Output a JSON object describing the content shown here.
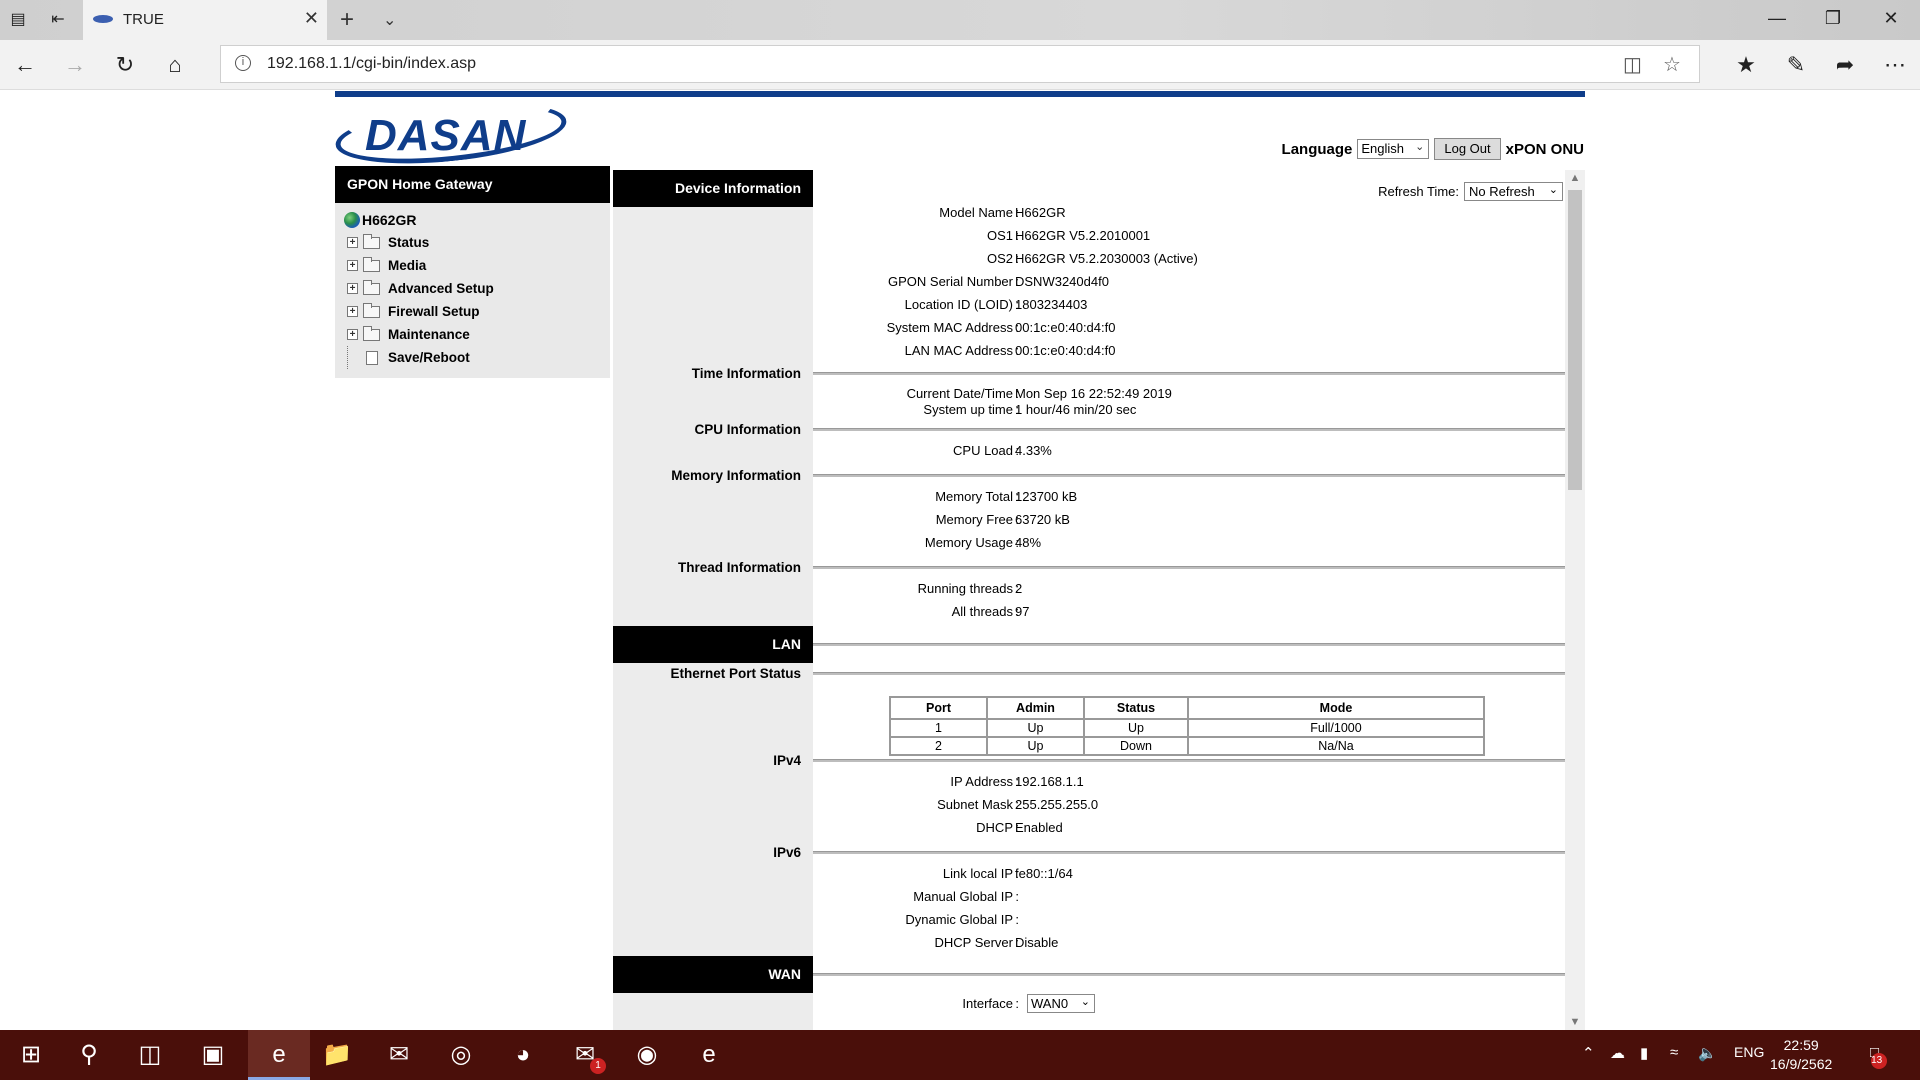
{
  "browser": {
    "tab_title": "TRUE",
    "url": "192.168.1.1/cgi-bin/index.asp"
  },
  "header": {
    "logo_text": "DASAN",
    "language_label": "Language",
    "language_value": "English",
    "logout_label": "Log Out",
    "product_name": "xPON ONU",
    "brand_color": "#0f3d8a"
  },
  "nav": {
    "title": "GPON Home Gateway",
    "root": "H662GR",
    "items": [
      {
        "label": "Status",
        "expandable": true
      },
      {
        "label": "Media",
        "expandable": true
      },
      {
        "label": "Advanced Setup",
        "expandable": true
      },
      {
        "label": "Firewall Setup",
        "expandable": true
      },
      {
        "label": "Maintenance",
        "expandable": true
      },
      {
        "label": "Save/Reboot",
        "expandable": false
      }
    ]
  },
  "refresh": {
    "label": "Refresh Time:",
    "value": "No Refresh"
  },
  "device_info": {
    "heading": "Device Information",
    "rows": [
      {
        "k": "Model Name",
        "v": "H662GR"
      },
      {
        "k": "OS1",
        "v": "H662GR V5.2.2010001"
      },
      {
        "k": "OS2",
        "v": "H662GR V5.2.2030003  (Active)"
      },
      {
        "k": "GPON Serial Number",
        "v": "DSNW3240d4f0"
      },
      {
        "k": "Location ID (LOID)",
        "v": "1803234403"
      },
      {
        "k": "System MAC Address",
        "v": "00:1c:e0:40:d4:f0"
      },
      {
        "k": "LAN MAC Address",
        "v": "00:1c:e0:40:d4:f0"
      }
    ]
  },
  "time_info": {
    "heading": "Time Information",
    "rows": [
      {
        "k": "Current Date/Time",
        "v": "Mon Sep 16 22:52:49 2019"
      },
      {
        "k": "System up time",
        "v": "1 hour/46 min/20 sec"
      }
    ]
  },
  "cpu_info": {
    "heading": "CPU Information",
    "rows": [
      {
        "k": "CPU Load",
        "v": "4.33%"
      }
    ]
  },
  "memory_info": {
    "heading": "Memory Information",
    "rows": [
      {
        "k": "Memory Total",
        "v": "123700 kB"
      },
      {
        "k": "Memory Free",
        "v": "63720 kB"
      },
      {
        "k": "Memory Usage",
        "v": "48%"
      }
    ]
  },
  "thread_info": {
    "heading": "Thread Information",
    "rows": [
      {
        "k": "Running threads",
        "v": "2"
      },
      {
        "k": "All threads",
        "v": "97"
      }
    ]
  },
  "lan": {
    "heading": "LAN",
    "ethernet_heading": "Ethernet Port Status",
    "columns": [
      "Port",
      "Admin",
      "Status",
      "Mode"
    ],
    "ports": [
      [
        "1",
        "Up",
        "Up",
        "Full/1000"
      ],
      [
        "2",
        "Up",
        "Down",
        "Na/Na"
      ]
    ],
    "ipv4_heading": "IPv4",
    "ipv4_rows": [
      {
        "k": "IP Address",
        "v": "192.168.1.1"
      },
      {
        "k": "Subnet Mask",
        "v": "255.255.255.0"
      },
      {
        "k": "DHCP",
        "v": "Enabled"
      }
    ],
    "ipv6_heading": "IPv6",
    "ipv6_rows": [
      {
        "k": "Link local IP",
        "v": "fe80::1/64"
      },
      {
        "k": "Manual Global IP",
        "v": ""
      },
      {
        "k": "Dynamic Global IP",
        "v": ""
      },
      {
        "k": "DHCP Server",
        "v": "Disable"
      }
    ]
  },
  "wan": {
    "heading": "WAN",
    "interface_label": "Interface",
    "interface_value": "WAN0"
  },
  "taskbar": {
    "language": "ENG",
    "time": "22:59",
    "date": "16/9/2562",
    "notification_count": "13",
    "messenger_badge": "1"
  }
}
